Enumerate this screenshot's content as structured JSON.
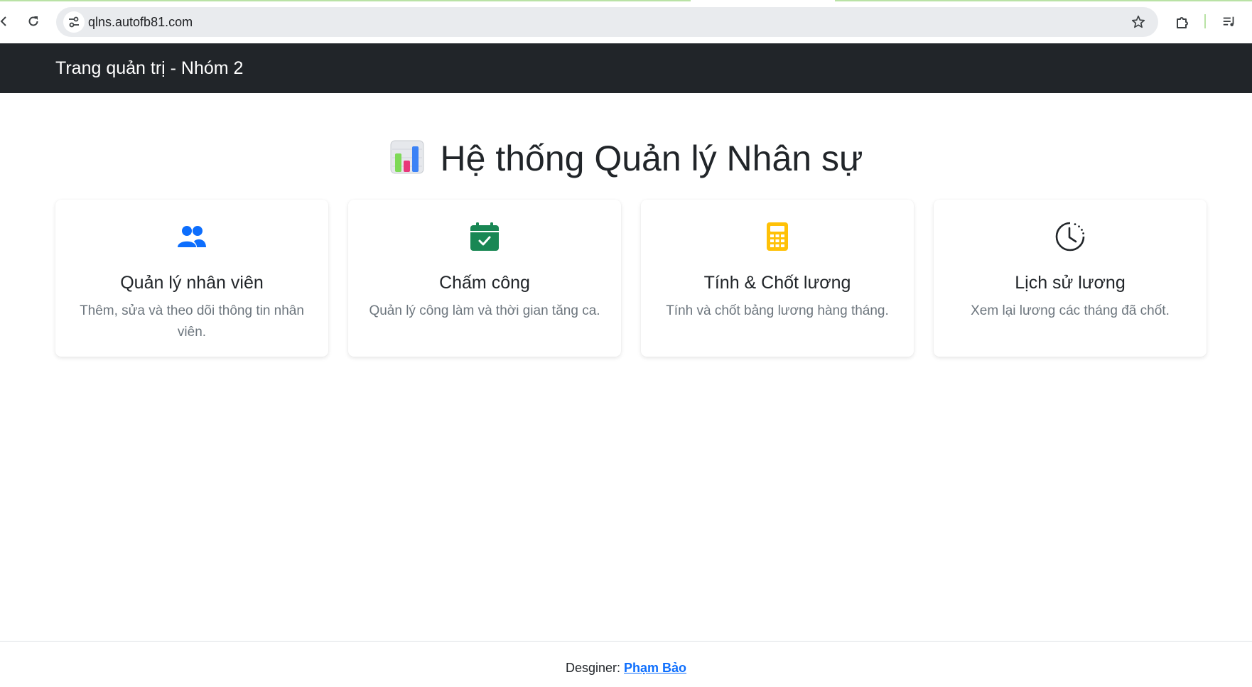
{
  "browser": {
    "url": "qlns.autofb81.com",
    "icons": {
      "back": "arrow-left-icon",
      "reload": "reload-icon",
      "site_info": "tune-icon",
      "bookmark": "star-icon",
      "extensions": "puzzle-icon",
      "media": "media-queue-icon"
    }
  },
  "navbar": {
    "brand": "Trang quản trị - Nhóm 2",
    "background": "#212529"
  },
  "main": {
    "title": "Hệ thống Quản lý Nhân sự",
    "title_icon": "bar-chart-emoji-icon"
  },
  "cards": [
    {
      "title": "Quản lý nhân viên",
      "description": "Thêm, sửa và theo dõi thông tin nhân viên.",
      "icon": "people-icon",
      "icon_color": "#0d6efd"
    },
    {
      "title": "Chấm công",
      "description": "Quản lý công làm và thời gian tăng ca.",
      "icon": "calendar-check-icon",
      "icon_color": "#198754"
    },
    {
      "title": "Tính & Chốt lương",
      "description": "Tính và chốt bảng lương hàng tháng.",
      "icon": "calculator-icon",
      "icon_color": "#ffc107"
    },
    {
      "title": "Lịch sử lương",
      "description": "Xem lại lương các tháng đã chốt.",
      "icon": "clock-history-icon",
      "icon_color": "#212529"
    }
  ],
  "footer": {
    "label": "Desginer:",
    "author": "Phạm Bảo",
    "link_color": "#0d6efd"
  }
}
